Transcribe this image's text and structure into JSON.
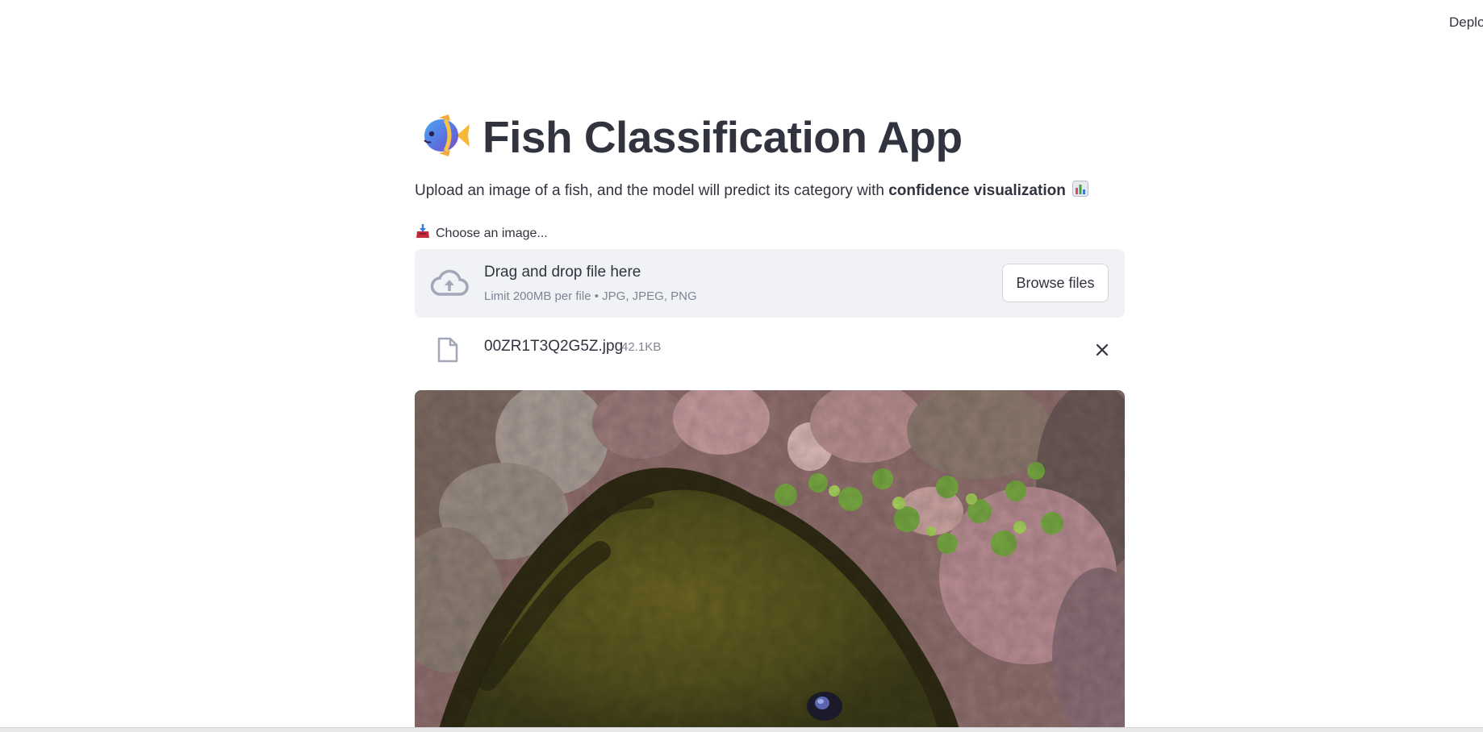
{
  "header": {
    "deploy_label": "Deploy"
  },
  "page": {
    "title_icon": "tropical-fish-icon",
    "title": "Fish Classification App",
    "subtitle_prefix": "Upload an image of a fish, and the model will predict its category with ",
    "subtitle_bold": "confidence visualization",
    "subtitle_icon": "bar-chart-icon"
  },
  "uploader": {
    "label_icon": "inbox-tray-icon",
    "label": "Choose an image...",
    "dropzone_icon": "cloud-upload-icon",
    "dropzone_title": "Drag and drop file here",
    "dropzone_limit": "Limit 200MB per file • JPG, JPEG, PNG",
    "browse_label": "Browse files"
  },
  "uploaded_file": {
    "icon": "file-icon",
    "name": "00ZR1T3Q2G5Z.jpg",
    "size": "42.1KB",
    "remove_icon": "close-icon"
  },
  "preview": {
    "subject": "moray eel among coral reef"
  },
  "colors": {
    "text": "#31333f",
    "muted": "#808495",
    "dropzone_bg": "#f0f2f6",
    "icon_gray": "#a3a8b8"
  }
}
